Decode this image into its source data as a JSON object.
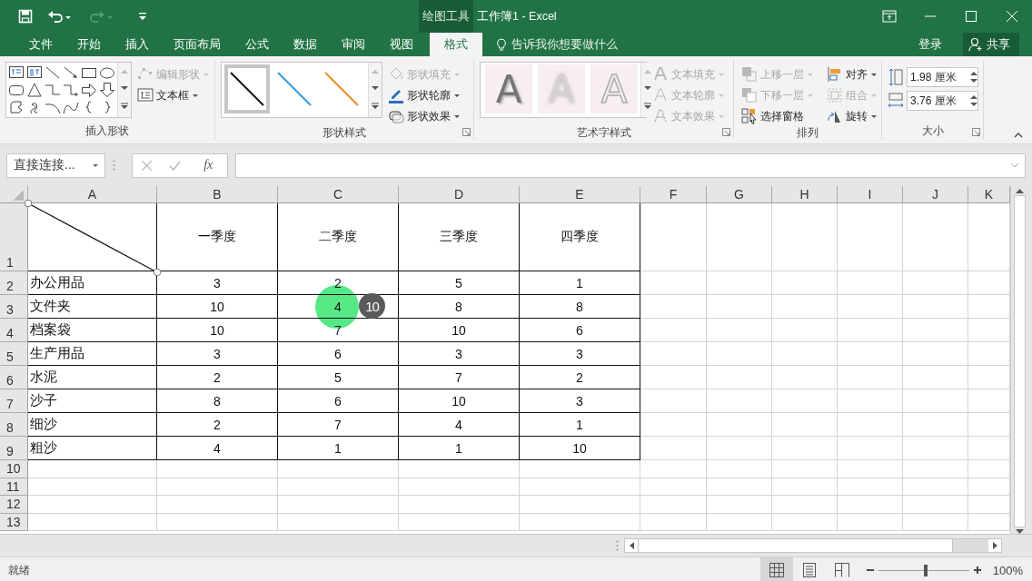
{
  "title_bar": {
    "context_label": "绘图工具",
    "title": "工作簿1 - Excel"
  },
  "quick_access": [
    {
      "kind": "save",
      "disabled": false
    },
    {
      "kind": "undo",
      "disabled": false
    },
    {
      "kind": "redo",
      "disabled": true
    },
    {
      "kind": "customize",
      "disabled": false
    }
  ],
  "ribbon_tabs": [
    {
      "label": "文件",
      "selected": false
    },
    {
      "label": "开始",
      "selected": false
    },
    {
      "label": "插入",
      "selected": false
    },
    {
      "label": "页面布局",
      "selected": false
    },
    {
      "label": "公式",
      "selected": false
    },
    {
      "label": "数据",
      "selected": false
    },
    {
      "label": "审阅",
      "selected": false
    },
    {
      "label": "视图",
      "selected": false
    },
    {
      "label": "格式",
      "selected": true
    }
  ],
  "tell_me": "告诉我你想要做什么",
  "sign_in": "登录",
  "share": "共享",
  "ribbon": {
    "insert_shapes": {
      "label": "插入形状",
      "commands": [
        {
          "kind": "edit_shape",
          "label": "编辑形状",
          "disabled": true
        },
        {
          "kind": "text_box",
          "label": "文本框",
          "disabled": false
        }
      ]
    },
    "shape_styles": {
      "label": "形状样式",
      "presets": [
        {
          "color": "#1a1a1a",
          "selected": true
        },
        {
          "color": "#3a9ee0",
          "selected": false
        },
        {
          "color": "#ee8f2c",
          "selected": false
        }
      ],
      "commands": [
        {
          "kind": "fill",
          "label": "形状填充",
          "disabled": true
        },
        {
          "kind": "outline",
          "label": "形状轮廓",
          "disabled": false
        },
        {
          "kind": "effects",
          "label": "形状效果",
          "disabled": false
        }
      ]
    },
    "wordart_styles": {
      "label": "艺术字样式",
      "samples": [
        {
          "kind": "shadow",
          "text": "A"
        },
        {
          "kind": "soft",
          "text": "A"
        },
        {
          "kind": "outline",
          "text": "A"
        }
      ],
      "commands": [
        {
          "kind": "text_fill",
          "label": "文本填充",
          "disabled": true
        },
        {
          "kind": "text_outline",
          "label": "文本轮廓",
          "disabled": true
        },
        {
          "kind": "text_effects",
          "label": "文本效果",
          "disabled": true
        }
      ]
    },
    "arrange": {
      "label": "排列",
      "commands": [
        {
          "kind": "bring_forward",
          "label": "上移一层",
          "disabled": true
        },
        {
          "kind": "align",
          "label": "对齐",
          "disabled": false
        },
        {
          "kind": "send_backward",
          "label": "下移一层",
          "disabled": true
        },
        {
          "kind": "group",
          "label": "组合",
          "disabled": true
        },
        {
          "kind": "selection_pane",
          "label": "选择窗格",
          "disabled": false
        },
        {
          "kind": "rotate",
          "label": "旋转",
          "disabled": false
        }
      ]
    },
    "size": {
      "label": "大小",
      "height": "1.98 厘米",
      "width": "3.76 厘米"
    }
  },
  "name_box": "直接连接...",
  "formula_bar": {
    "function_label": "fx"
  },
  "columns": [
    "A",
    "B",
    "C",
    "D",
    "E",
    "F",
    "G",
    "H",
    "I",
    "J",
    "K"
  ],
  "header_row": {
    "number": "1",
    "headings": [
      "一季度",
      "二季度",
      "三季度",
      "四季度"
    ]
  },
  "rows": [
    {
      "number": "2",
      "item": "办公用品",
      "values": [
        "3",
        "2",
        "5",
        "1"
      ]
    },
    {
      "number": "3",
      "item": "文件夹",
      "values": [
        "10",
        "4",
        "8",
        "8"
      ]
    },
    {
      "number": "4",
      "item": "档案袋",
      "values": [
        "10",
        "7",
        "10",
        "6"
      ]
    },
    {
      "number": "5",
      "item": "生产用品",
      "values": [
        "3",
        "6",
        "3",
        "3"
      ]
    },
    {
      "number": "6",
      "item": "水泥",
      "values": [
        "2",
        "5",
        "7",
        "2"
      ]
    },
    {
      "number": "7",
      "item": "沙子",
      "values": [
        "8",
        "6",
        "10",
        "3"
      ]
    },
    {
      "number": "8",
      "item": "细沙",
      "values": [
        "2",
        "7",
        "4",
        "1"
      ]
    },
    {
      "number": "9",
      "item": "粗沙",
      "values": [
        "4",
        "1",
        "1",
        "10"
      ]
    }
  ],
  "empty_rows": [
    "10",
    "11",
    "12",
    "13"
  ],
  "shape": {
    "kind": "diagonal_line",
    "selected": true
  },
  "click_marker": {
    "badge": "10"
  },
  "status_bar": {
    "status": "就绪",
    "views": [
      {
        "kind": "normal",
        "selected": true
      },
      {
        "kind": "page_layout",
        "selected": false
      },
      {
        "kind": "page_break",
        "selected": false
      }
    ],
    "zoom": {
      "level": 0.52,
      "label": "100%"
    }
  }
}
